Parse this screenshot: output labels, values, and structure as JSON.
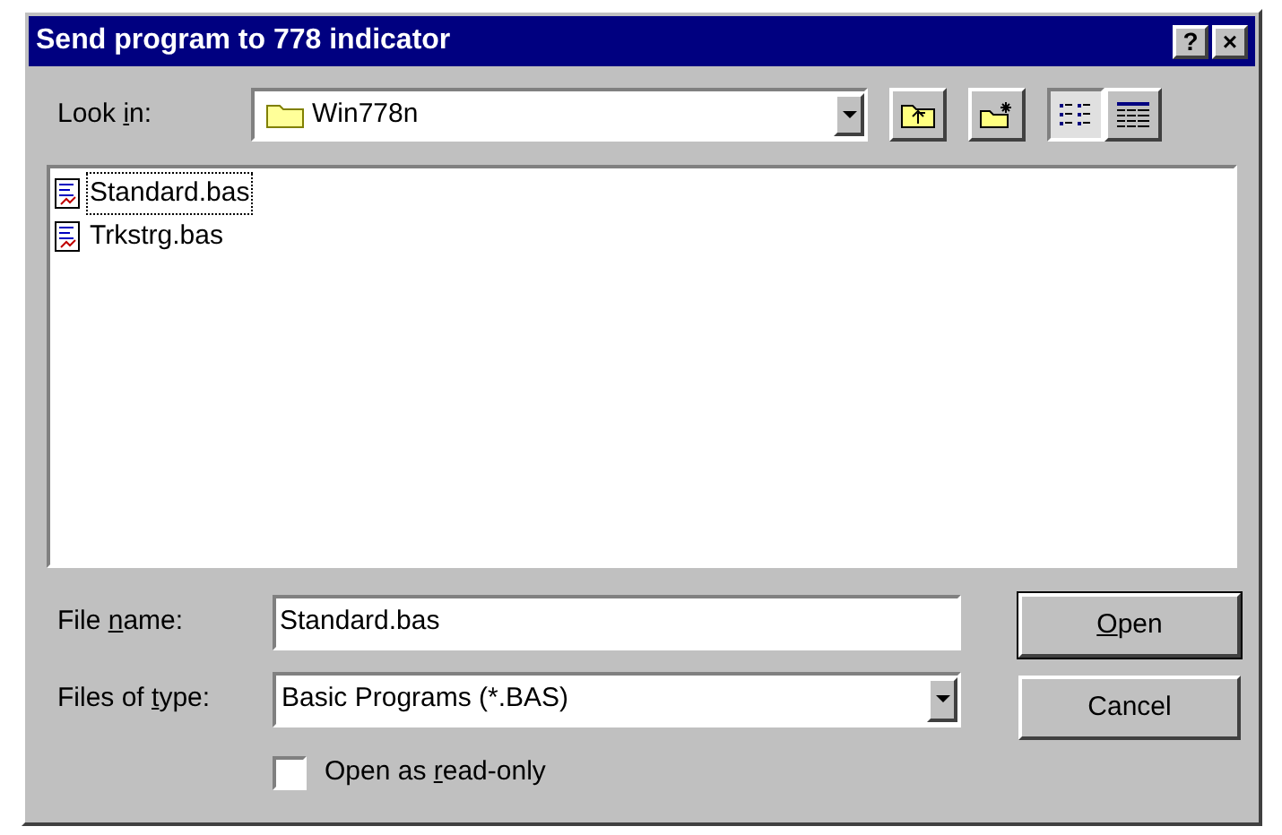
{
  "window": {
    "title": "Send program to 778 indicator",
    "title_buttons": [
      "?",
      "×"
    ]
  },
  "look_in": {
    "label": {
      "pre": "Look ",
      "key": "i",
      "post": "n:"
    },
    "value": "Win778n"
  },
  "toolbar": [
    {
      "kind": "up"
    },
    {
      "kind": "new_folder"
    },
    {
      "kind": "list",
      "selected": true
    },
    {
      "kind": "details",
      "selected": false
    }
  ],
  "files": [
    {
      "name": "Standard.bas",
      "focused": true
    },
    {
      "name": "Trkstrg.bas",
      "focused": false
    }
  ],
  "file_name": {
    "label": {
      "pre": "File ",
      "key": "n",
      "post": "ame:"
    },
    "value": "Standard.bas"
  },
  "file_type": {
    "label": {
      "pre": "Files of ",
      "key": "t",
      "post": "ype:"
    },
    "value": "Basic Programs (*.BAS)"
  },
  "read_only": {
    "label": {
      "pre": "Open as ",
      "key": "r",
      "post": "ead-only"
    },
    "checked": false
  },
  "buttons": [
    {
      "label": {
        "key": "O",
        "post": "pen"
      },
      "default": true
    },
    {
      "label": {
        "pre": "Cancel"
      },
      "default": false
    }
  ]
}
